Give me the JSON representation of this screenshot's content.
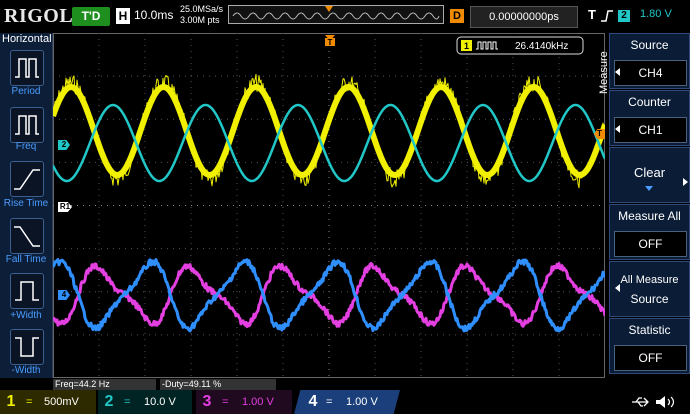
{
  "top": {
    "logo": "RIGOL",
    "trigger_status": "T'D",
    "horizontal_badge": "H",
    "timebase": "10.0ms",
    "sample_rate": "25.0MSa/s",
    "memory_points": "3.00M pts",
    "delay_badge": "D",
    "delay_value": "0.00000000ps",
    "trigger_badge": "T",
    "trigger_source": "2",
    "trigger_level": "1.80 V"
  },
  "left": {
    "header": "Horizontal",
    "items": [
      "Period",
      "Freq",
      "Rise Time",
      "Fall Time",
      "+Width",
      "-Width"
    ]
  },
  "right": {
    "tab_label": "Measure",
    "source_label": "Source",
    "source_value": "CH4",
    "counter_label": "Counter",
    "counter_value": "CH1",
    "clear_label": "Clear",
    "measure_all_label": "Measure All",
    "measure_all_value": "OFF",
    "all_measure_label": "All Measure",
    "all_measure_sub": "Source",
    "statistic_label": "Statistic",
    "statistic_value": "OFF"
  },
  "counter_readout": {
    "channel": "1",
    "value": "26.4140kHz"
  },
  "measurements": {
    "freq": "Freq=44.2 Hz",
    "duty": "-Duty=49.11 %"
  },
  "markers": {
    "ch2": "2",
    "ch4": "4",
    "ref": "R1",
    "trig_right": "T"
  },
  "channels": [
    {
      "num": "1",
      "scale": "500mV",
      "color": "#f0f000"
    },
    {
      "num": "2",
      "scale": "10.0 V",
      "color": "#21c7c7"
    },
    {
      "num": "3",
      "scale": "1.00 V",
      "color": "#e43fe0"
    },
    {
      "num": "4",
      "scale": "1.00 V",
      "color": "#2f8fff"
    }
  ]
}
